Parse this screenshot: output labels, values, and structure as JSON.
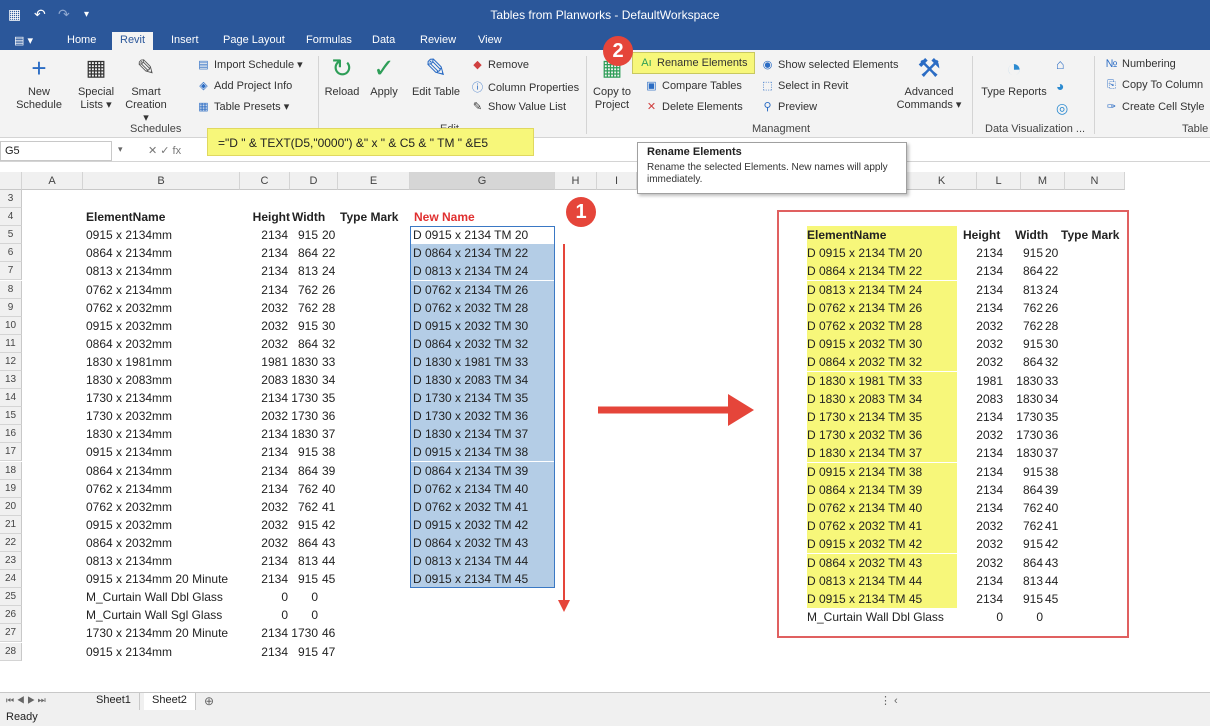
{
  "window": {
    "title": "Tables from Planworks - DefaultWorkspace"
  },
  "tabs": [
    "Home",
    "Revit",
    "Insert",
    "Page Layout",
    "Formulas",
    "Data",
    "Review",
    "View"
  ],
  "ribbon": {
    "new_schedule": "New Schedule",
    "special_lists": "Special Lists ▾",
    "smart_creation": "Smart Creation ▾",
    "import_schedule": "Import Schedule ▾",
    "add_project_info": "Add Project Info",
    "table_presets": "Table Presets ▾",
    "group_schedules": "Schedules",
    "reload": "Reload",
    "apply": "Apply",
    "edit_table": "Edit Table",
    "remove": "Remove",
    "column_properties": "Column Properties",
    "show_value_list": "Show Value List",
    "group_edit": "Edit",
    "copy_to_project": "Copy to Project",
    "rename_elements": "Rename Elements",
    "compare_tables": "Compare Tables",
    "delete_elements": "Delete Elements",
    "show_selected": "Show selected Elements",
    "select_in_revit": "Select in Revit",
    "preview": "Preview",
    "advanced_commands": "Advanced Commands ▾",
    "group_managment": "Managment",
    "type_reports": "Type Reports",
    "group_data_vis": "Data Visualization ...",
    "numbering": "Numbering",
    "copy_to_column": "Copy To Column",
    "create_cell_style": "Create Cell Style",
    "group_table": "Table"
  },
  "formula_bar": {
    "name_box": "G5",
    "formula": "=\"D \" & TEXT(D5,\"0000\") &\" x \" & C5 & \" TM \" &E5"
  },
  "tooltip": {
    "title": "Rename Elements",
    "desc": "Rename the selected Elements. New names will apply immediately."
  },
  "columns": [
    "A",
    "B",
    "C",
    "D",
    "E",
    "G",
    "H",
    "I",
    "K",
    "L",
    "M",
    "N"
  ],
  "rows": [
    "3",
    "4",
    "5",
    "6",
    "7",
    "8",
    "9",
    "10",
    "11",
    "12",
    "13",
    "14",
    "15",
    "16",
    "17",
    "18",
    "19",
    "20",
    "21",
    "22",
    "23",
    "24",
    "25",
    "26",
    "27",
    "28"
  ],
  "row_labels": [
    "2"
  ],
  "table_headers": {
    "name": "ElementName",
    "height": "Height",
    "width": "Width",
    "type_mark": "Type Mark",
    "new_name": "New Name"
  },
  "table": [
    [
      "0915 x 2134mm",
      "2134",
      "915",
      "20",
      "D 0915 x 2134 TM 20"
    ],
    [
      "0864 x 2134mm",
      "2134",
      "864",
      "22",
      "D 0864 x 2134 TM 22"
    ],
    [
      "0813 x 2134mm",
      "2134",
      "813",
      "24",
      "D 0813 x 2134 TM 24"
    ],
    [
      "0762 x 2134mm",
      "2134",
      "762",
      "26",
      "D 0762 x 2134 TM 26"
    ],
    [
      "0762 x 2032mm",
      "2032",
      "762",
      "28",
      "D 0762 x 2032 TM 28"
    ],
    [
      "0915 x 2032mm",
      "2032",
      "915",
      "30",
      "D 0915 x 2032 TM 30"
    ],
    [
      "0864 x 2032mm",
      "2032",
      "864",
      "32",
      "D 0864 x 2032 TM 32"
    ],
    [
      "1830 x 1981mm",
      "1981",
      "1830",
      "33",
      "D 1830 x 1981 TM 33"
    ],
    [
      "1830 x 2083mm",
      "2083",
      "1830",
      "34",
      "D 1830 x 2083 TM 34"
    ],
    [
      "1730 x 2134mm",
      "2134",
      "1730",
      "35",
      "D 1730 x 2134 TM 35"
    ],
    [
      "1730 x 2032mm",
      "2032",
      "1730",
      "36",
      "D 1730 x 2032 TM 36"
    ],
    [
      "1830 x 2134mm",
      "2134",
      "1830",
      "37",
      "D 1830 x 2134 TM 37"
    ],
    [
      "0915 x 2134mm",
      "2134",
      "915",
      "38",
      "D 0915 x 2134 TM 38"
    ],
    [
      "0864 x 2134mm",
      "2134",
      "864",
      "39",
      "D 0864 x 2134 TM 39"
    ],
    [
      "0762 x 2134mm",
      "2134",
      "762",
      "40",
      "D 0762 x 2134 TM 40"
    ],
    [
      "0762 x 2032mm",
      "2032",
      "762",
      "41",
      "D 0762 x 2032 TM 41"
    ],
    [
      "0915 x 2032mm",
      "2032",
      "915",
      "42",
      "D 0915 x 2032 TM 42"
    ],
    [
      "0864 x 2032mm",
      "2032",
      "864",
      "43",
      "D 0864 x 2032 TM 43"
    ],
    [
      "0813 x 2134mm",
      "2134",
      "813",
      "44",
      "D 0813 x 2134 TM 44"
    ],
    [
      "0915 x 2134mm 20 Minute",
      "2134",
      "915",
      "45",
      "D 0915 x 2134 TM 45"
    ],
    [
      "M_Curtain Wall Dbl Glass",
      "0",
      "0",
      "",
      ""
    ],
    [
      "M_Curtain Wall Sgl Glass",
      "0",
      "0",
      "",
      ""
    ],
    [
      "1730 x 2134mm 20 Minute",
      "2134",
      "1730",
      "46",
      ""
    ],
    [
      "0915 x 2134mm",
      "2134",
      "915",
      "47",
      ""
    ]
  ],
  "result_headers": {
    "name": "ElementName",
    "height": "Height",
    "width": "Width",
    "type_mark": "Type Mark"
  },
  "result_table": [
    [
      "D 0915 x 2134 TM 20",
      "2134",
      "915",
      "20"
    ],
    [
      "D 0864 x 2134 TM 22",
      "2134",
      "864",
      "22"
    ],
    [
      "D 0813 x 2134 TM 24",
      "2134",
      "813",
      "24"
    ],
    [
      "D 0762 x 2134 TM 26",
      "2134",
      "762",
      "26"
    ],
    [
      "D 0762 x 2032 TM 28",
      "2032",
      "762",
      "28"
    ],
    [
      "D 0915 x 2032 TM 30",
      "2032",
      "915",
      "30"
    ],
    [
      "D 0864 x 2032 TM 32",
      "2032",
      "864",
      "32"
    ],
    [
      "D 1830 x 1981 TM 33",
      "1981",
      "1830",
      "33"
    ],
    [
      "D 1830 x 2083 TM 34",
      "2083",
      "1830",
      "34"
    ],
    [
      "D 1730 x 2134 TM 35",
      "2134",
      "1730",
      "35"
    ],
    [
      "D 1730 x 2032 TM 36",
      "2032",
      "1730",
      "36"
    ],
    [
      "D 1830 x 2134 TM 37",
      "2134",
      "1830",
      "37"
    ],
    [
      "D 0915 x 2134 TM 38",
      "2134",
      "915",
      "38"
    ],
    [
      "D 0864 x 2134 TM 39",
      "2134",
      "864",
      "39"
    ],
    [
      "D 0762 x 2134 TM 40",
      "2134",
      "762",
      "40"
    ],
    [
      "D 0762 x 2032 TM 41",
      "2032",
      "762",
      "41"
    ],
    [
      "D 0915 x 2032 TM 42",
      "2032",
      "915",
      "42"
    ],
    [
      "D 0864 x 2032 TM 43",
      "2032",
      "864",
      "43"
    ],
    [
      "D 0813 x 2134 TM 44",
      "2134",
      "813",
      "44"
    ],
    [
      "D 0915 x 2134 TM 45",
      "2134",
      "915",
      "45"
    ],
    [
      "M_Curtain Wall Dbl Glass",
      "0",
      "0",
      ""
    ]
  ],
  "sheets": [
    "Sheet1",
    "Sheet2"
  ],
  "status": "Ready",
  "badges": [
    "1",
    "2"
  ],
  "colors": {
    "title": "#2b579a",
    "highlight_yellow": "#f7f77a",
    "selection_blue": "#b4cde6",
    "annotation_red": "#e5453a",
    "new_name_red": "#e03030"
  }
}
